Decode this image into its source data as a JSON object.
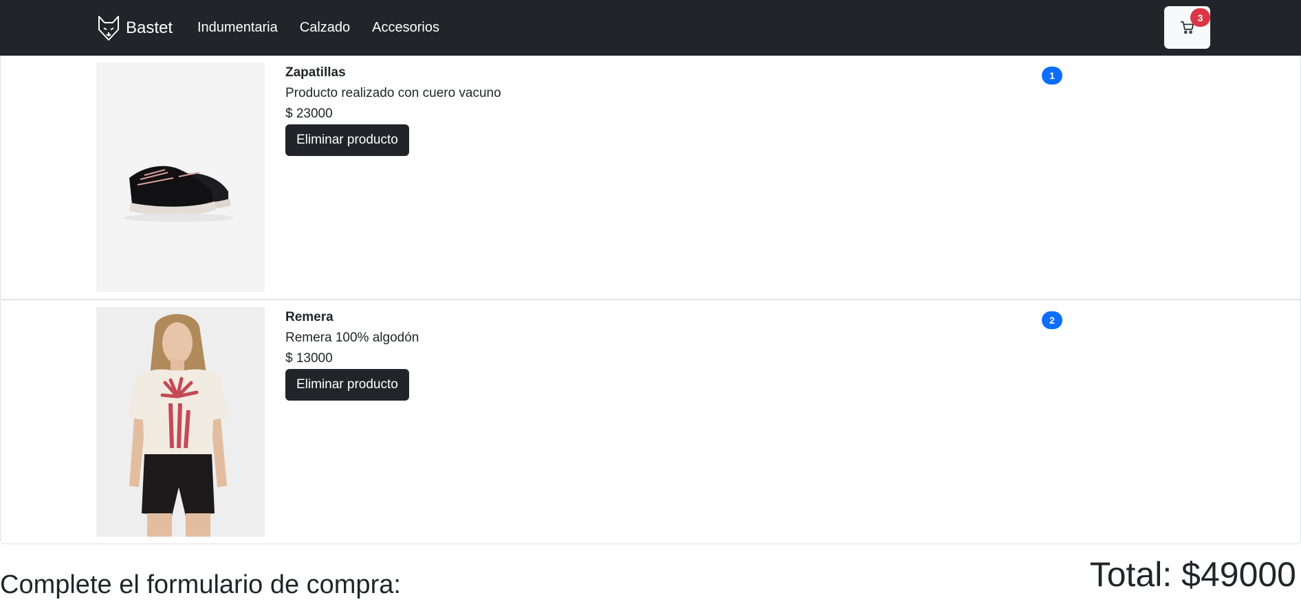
{
  "navbar": {
    "brand": "Bastet",
    "links": [
      {
        "label": "Indumentaria"
      },
      {
        "label": "Calzado"
      },
      {
        "label": "Accesorios"
      }
    ],
    "cart_count": "3",
    "brand_logo_icon": "cat-face-icon",
    "cart_icon": "shopping-cart-icon"
  },
  "cart": {
    "items": [
      {
        "name": "Zapatillas",
        "description": "Producto realizado con cuero vacuno",
        "price": "$ 23000",
        "remove_label": "Eliminar producto",
        "badge": "1"
      },
      {
        "name": "Remera",
        "description": "Remera 100% algodón",
        "price": "$ 13000",
        "remove_label": "Eliminar producto",
        "badge": "2"
      }
    ]
  },
  "checkout": {
    "heading": "Complete el formulario de compra:",
    "total": "Total: $49000"
  },
  "colors": {
    "navbar_bg": "#212529",
    "badge_red": "#dc3545",
    "badge_blue": "#0d6efd",
    "button_dark": "#212529"
  }
}
